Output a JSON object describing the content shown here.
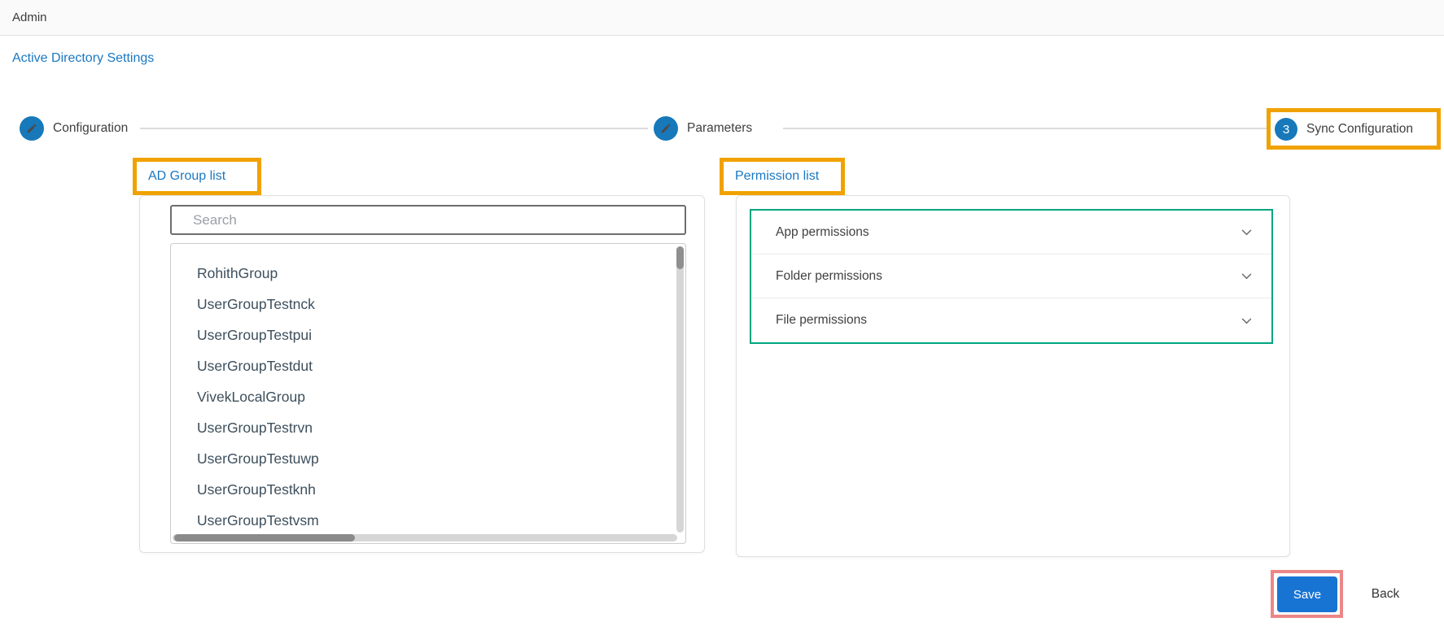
{
  "topbar": {
    "title": "Admin"
  },
  "nav": {
    "settings_link": "Active Directory Settings"
  },
  "stepper": {
    "steps": [
      {
        "label": "Configuration",
        "icon": "edit-icon"
      },
      {
        "label": "Parameters",
        "icon": "edit-icon"
      },
      {
        "label": "Sync Configuration",
        "number": "3"
      }
    ]
  },
  "ad_group_panel": {
    "title": "AD Group list",
    "search": {
      "placeholder": "Search",
      "value": ""
    },
    "groups": [
      "RohithGroup",
      "UserGroupTestnck",
      "UserGroupTestpui",
      "UserGroupTestdut",
      "VivekLocalGroup",
      "UserGroupTestrvn",
      "UserGroupTestuwp",
      "UserGroupTestknh",
      "UserGroupTestvsm"
    ]
  },
  "permission_panel": {
    "title": "Permission list",
    "sections": [
      {
        "label": "App permissions",
        "icon": "chevron-down-icon"
      },
      {
        "label": "Folder permissions",
        "icon": "chevron-down-icon"
      },
      {
        "label": "File permissions",
        "icon": "chevron-down-icon"
      }
    ]
  },
  "footer": {
    "save_label": "Save",
    "back_label": "Back"
  },
  "annotations": {
    "orange_boxed_elements": [
      "Sync Configuration",
      "AD Group list",
      "Permission list"
    ],
    "red_boxed_elements": [
      "Save"
    ]
  },
  "colors": {
    "link_blue": "#1a78c2",
    "stepper_blue": "#1779ba",
    "save_blue": "#1874d3",
    "highlight_orange": "#f0a202",
    "highlight_red": "#ec8787",
    "accent_green": "#00a67e"
  }
}
